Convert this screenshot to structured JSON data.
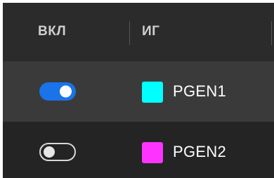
{
  "table": {
    "columns": {
      "enabled_label": "ВКЛ",
      "generator_label": "ИГ"
    },
    "rows": [
      {
        "enabled": true,
        "name": "PGEN1",
        "color": "#00ffff"
      },
      {
        "enabled": false,
        "name": "PGEN2",
        "color": "#ff33ff"
      }
    ]
  }
}
